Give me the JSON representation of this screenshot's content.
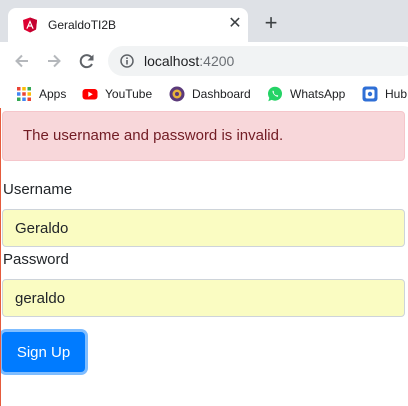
{
  "browser": {
    "tab_title": "GeraldoTI2B",
    "url_host": "localhost",
    "url_port": ":4200",
    "bookmarks": [
      {
        "label": "Apps",
        "icon": "apps-grid-icon"
      },
      {
        "label": "YouTube",
        "icon": "youtube-icon"
      },
      {
        "label": "Dashboard",
        "icon": "dashboard-icon"
      },
      {
        "label": "WhatsApp",
        "icon": "whatsapp-icon"
      },
      {
        "label": "Hub",
        "icon": "hub-icon"
      }
    ]
  },
  "page": {
    "alert": "The username and password is invalid.",
    "username_label": "Username",
    "username_value": "Geraldo",
    "password_label": "Password",
    "password_value": "geraldo",
    "submit_label": "Sign Up"
  },
  "colors": {
    "alert_bg": "#f8d7da",
    "alert_text": "#721c24",
    "autofill_bg": "#fafcc2",
    "primary": "#007bff"
  }
}
